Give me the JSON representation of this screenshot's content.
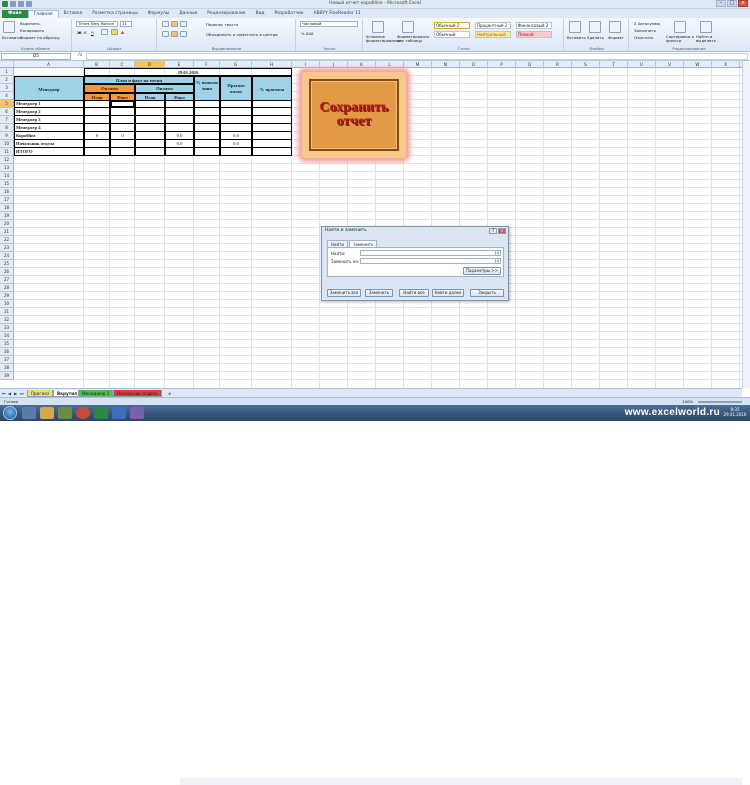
{
  "window": {
    "title": "Новый отчет коробline - Microsoft Excel"
  },
  "ribbon_tabs": [
    "Файл",
    "Главная",
    "Вставка",
    "Разметка страницы",
    "Формулы",
    "Данные",
    "Рецензирование",
    "Вид",
    "Разработчик",
    "ABBYY FineReader 11"
  ],
  "ribbon": {
    "paste_label": "Вставить",
    "cut": "Вырезать",
    "copy": "Копировать",
    "format_painter": "Формат по образцу",
    "clipboard_group": "Буфер обмена",
    "font_name": "Times New Roman",
    "font_size": "11",
    "font_group": "Шрифт",
    "wrap_text": "Перенос текста",
    "merge_center": "Объединить и поместить в центре",
    "alignment_group": "Выравнивание",
    "number_format": "Числовой",
    "number_group": "Число",
    "conditional_format": "Условное форматирование",
    "format_as_table": "Форматировать как таблицу",
    "styles": {
      "normal2": "Обычный 2",
      "percent2": "Процентный 2",
      "financial2": "Финансовый 2",
      "normal": "Обычный",
      "neutral": "Нейтральный",
      "bad": "Плохой"
    },
    "styles_group": "Стили",
    "insert": "Вставить",
    "delete": "Удалить",
    "format": "Формат",
    "cells_group": "Ячейки",
    "autosum": "Автосумма",
    "fill": "Заполнить",
    "clear": "Очистить",
    "sort_filter": "Сортировка и фильтр",
    "find_select": "Найти и выделить",
    "editing_group": "Редактирование",
    "colors": {
      "file_tab": "#2a8a3f",
      "header_fill": "#9fd4e8",
      "accent_fill": "#f29a3a"
    }
  },
  "formula_bar": {
    "name_box": "D5",
    "fx": "fx",
    "value": ""
  },
  "columns": [
    "A",
    "B",
    "C",
    "D",
    "E",
    "F",
    "G",
    "H",
    "I",
    "J",
    "K",
    "L",
    "M",
    "N",
    "O",
    "P",
    "Q",
    "R",
    "S",
    "T",
    "U",
    "V",
    "W",
    "X",
    "Y",
    "Z"
  ],
  "rows": [
    "1",
    "2",
    "3",
    "4",
    "5",
    "6",
    "7",
    "8",
    "9",
    "10",
    "11",
    "12",
    "13",
    "14",
    "15",
    "16",
    "17",
    "18",
    "19",
    "20",
    "21",
    "22",
    "23",
    "24",
    "25",
    "26",
    "27",
    "28",
    "29",
    "30",
    "31",
    "32",
    "33",
    "34",
    "35",
    "36",
    "37",
    "38",
    "39"
  ],
  "table": {
    "date": "29.01.2016",
    "manager_header": "Менеджер",
    "plan_fact": "План и факт на месяц",
    "payments1": "Оплаты",
    "payments2": "Оплаты",
    "plan1": "План",
    "fact1": "Факт",
    "plan2": "План",
    "fact2": "Факт",
    "pct_done": "% выполн ения",
    "forecast": "Прогноз оплат",
    "pct_forecast": "% прогноза",
    "rows": [
      {
        "name": "Менеджер 1",
        "c": "",
        "d": "",
        "f": "",
        "h": ""
      },
      {
        "name": "Менеджер 2",
        "c": "",
        "d": "",
        "f": "",
        "h": ""
      },
      {
        "name": "Менеджер 3",
        "c": "",
        "d": "",
        "f": "",
        "h": ""
      },
      {
        "name": "Менеджер 4",
        "c": "",
        "d": "",
        "f": "",
        "h": ""
      },
      {
        "name": "Коробline",
        "c": "0",
        "d": "0",
        "f": "0,0",
        "h": "0,0"
      },
      {
        "name": "Начальник отдела",
        "c": "",
        "d": "",
        "f": "0,0",
        "h": "0,0"
      },
      {
        "name": "ИТОГО",
        "c": "",
        "d": "",
        "f": "",
        "h": ""
      }
    ]
  },
  "shape_button": {
    "line1": "Сохранить",
    "line2": "отчет"
  },
  "find_dialog": {
    "title": "Найти и заменить",
    "tab_find": "Найти",
    "tab_replace": "Заменить",
    "find_label": "Найти:",
    "replace_label": "Заменить на:",
    "options_button": "Параметры >>",
    "replace_all": "Заменить все",
    "replace": "Заменить",
    "find_all": "Найти все",
    "find_next": "Найти далее",
    "close": "Закрыть"
  },
  "sheet_tabs": [
    {
      "label": "Прогноз",
      "color": "#e8e36a"
    },
    {
      "label": "Вкрутил",
      "color": "#ffffff"
    },
    {
      "label": "Менеджер 1",
      "color": "#4fbf4f"
    },
    {
      "label": "Начальник отдела",
      "color": "#e33b3b"
    }
  ],
  "status": {
    "ready": "Готово",
    "zoom": "100%"
  },
  "taskbar": {
    "watermark": "www.excelworld.ru",
    "time": "8:35",
    "date": "29.01.2016"
  }
}
